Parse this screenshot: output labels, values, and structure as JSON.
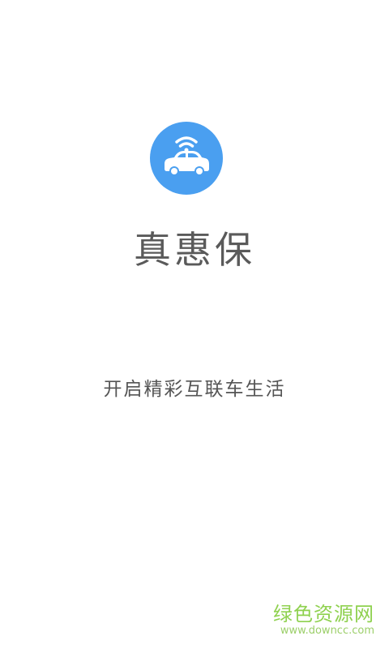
{
  "app": {
    "name": "真惠保",
    "slogan": "开启精彩互联车生活",
    "logo_icon": "connected-car-icon",
    "logo_color": "#4a9ff0"
  },
  "watermark": {
    "title": "绿色资源网",
    "url": "www.downcc.com",
    "color": "#8fd14f"
  }
}
